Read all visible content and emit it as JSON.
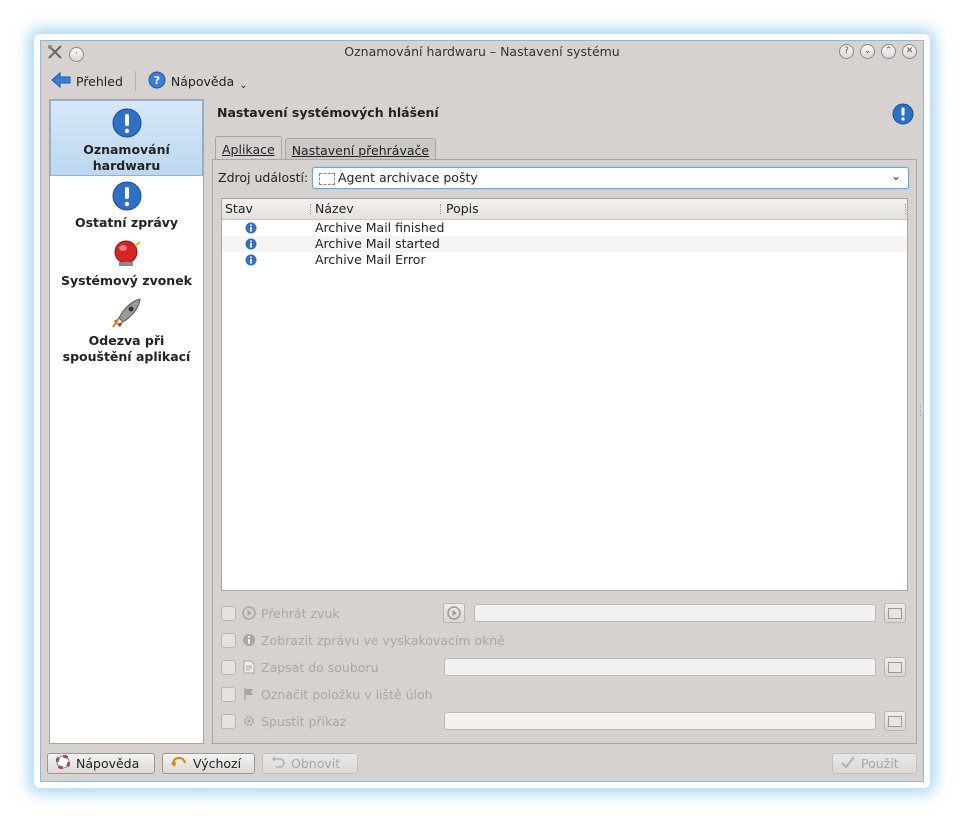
{
  "window": {
    "title": "Oznamování hardwaru – Nastavení systému",
    "controls": [
      "?",
      "⌄",
      "⌃",
      "✕"
    ]
  },
  "toolbar": {
    "overview_label": "Přehled",
    "help_label": "Nápověda"
  },
  "sidebar": {
    "items": [
      {
        "label_line1": "Oznamování",
        "label_line2": "hardwaru",
        "icon": "info-exclamation-icon",
        "selected": true
      },
      {
        "label_line1": "Ostatní zprávy",
        "icon": "info-exclamation-icon",
        "selected": false
      },
      {
        "label_line1": "Systémový zvonek",
        "icon": "bell-icon",
        "selected": false
      },
      {
        "label_line1": "Odezva při",
        "label_line2": "spouštění aplikací",
        "icon": "rocket-icon",
        "selected": false
      }
    ]
  },
  "main": {
    "header": "Nastavení systémových hlášení",
    "tabs": [
      {
        "label": "Aplikace",
        "active": true
      },
      {
        "label": "Nastavení přehrávače",
        "active": false
      }
    ],
    "source_label": "Zdroj událostí:",
    "source_value": "Agent archivace pošty",
    "table": {
      "columns": [
        "Stav",
        "Název",
        "Popis"
      ],
      "rows": [
        {
          "status_icon": "info-icon",
          "name": "Archive Mail finished",
          "description": ""
        },
        {
          "status_icon": "info-icon",
          "name": "Archive Mail started",
          "description": ""
        },
        {
          "status_icon": "info-icon",
          "name": "Archive Mail Error",
          "description": ""
        }
      ]
    },
    "options": {
      "play_sound": "Přehrát zvuk",
      "show_popup": "Zobrazit zprávu ve vyskakovacím okně",
      "log_to_file": "Zapsat do souboru",
      "mark_taskbar": "Označit položku v liště úloh",
      "run_command": "Spustit příkaz"
    }
  },
  "buttons": {
    "help": "Nápověda",
    "defaults": "Výchozí",
    "reset": "Obnovit",
    "apply": "Použít"
  },
  "colors": {
    "accent": "#3b7ed3",
    "window_bg": "#d6d2d0",
    "selection": "#c6ddf2",
    "disabled_text": "#a9a6a3"
  }
}
